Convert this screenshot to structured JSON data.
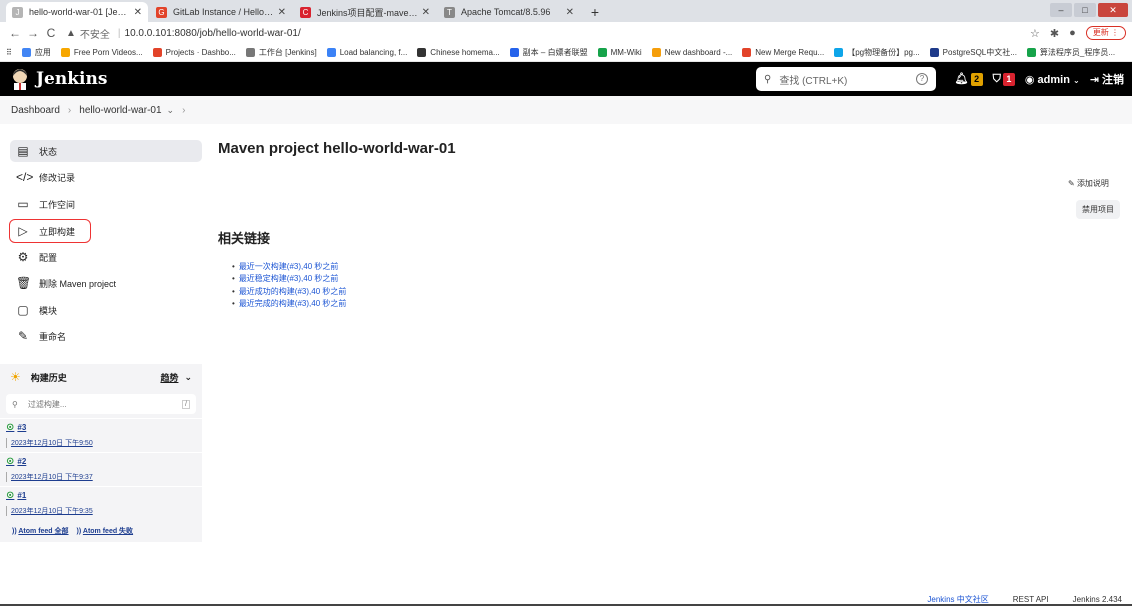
{
  "browser": {
    "tabs": [
      {
        "label": "hello-world-war-01 [Jenkins]",
        "color": "#b5b5b5",
        "active": true
      },
      {
        "label": "GitLab Instance / Hello World",
        "color": "#e24329",
        "active": false
      },
      {
        "label": "Jenkins项目配置-maven项目-全",
        "color": "#d9232f",
        "active": false
      },
      {
        "label": "Apache Tomcat/8.5.96",
        "color": "#888888",
        "active": false
      }
    ],
    "security_label": "不安全",
    "url": "10.0.0.101:8080/job/hello-world-war-01/",
    "update_label": "更新",
    "bookmarks": [
      {
        "label": "应用",
        "color": "#4285f4"
      },
      {
        "label": "Free Porn Videos...",
        "color": "#f7a700"
      },
      {
        "label": "Projects · Dashbo...",
        "color": "#e24329"
      },
      {
        "label": "工作台 [Jenkins]",
        "color": "#777777"
      },
      {
        "label": "Load balancing, f...",
        "color": "#3b82f6"
      },
      {
        "label": "Chinese homema...",
        "color": "#333333"
      },
      {
        "label": "副本 – 白嫖者联盟",
        "color": "#2563eb"
      },
      {
        "label": "MM-Wiki",
        "color": "#16a34a"
      },
      {
        "label": "New dashboard -...",
        "color": "#f59e0b"
      },
      {
        "label": "New Merge Requ...",
        "color": "#e24329"
      },
      {
        "label": "【pg物理备份】pg...",
        "color": "#0ea5e9"
      },
      {
        "label": "PostgreSQL中文社...",
        "color": "#1e3a8a"
      },
      {
        "label": "算法程序员_程序员...",
        "color": "#16a34a"
      }
    ]
  },
  "header": {
    "logo_text": "Jenkins",
    "search_placeholder": "查找 (CTRL+K)",
    "notifications_count": "2",
    "security_count": "1",
    "user": "admin",
    "logout": "注销"
  },
  "breadcrumb": {
    "dashboard": "Dashboard",
    "job": "hello-world-war-01"
  },
  "sidebar": {
    "tasks": [
      {
        "label": "状态",
        "icon": "status-icon"
      },
      {
        "label": "修改记录",
        "icon": "code-icon"
      },
      {
        "label": "工作空间",
        "icon": "folder-icon"
      },
      {
        "label": "立即构建",
        "icon": "play-icon"
      },
      {
        "label": "配置",
        "icon": "gear-icon"
      },
      {
        "label": "删除 Maven project",
        "icon": "trash-icon"
      },
      {
        "label": "模块",
        "icon": "document-icon"
      },
      {
        "label": "重命名",
        "icon": "pencil-icon"
      }
    ]
  },
  "build_history": {
    "title": "构建历史",
    "trend": "趋势",
    "filter_placeholder": "过滤构建...",
    "shortcut": "/",
    "builds": [
      {
        "number": "#3",
        "date": "2023年12月10日 下午9:50"
      },
      {
        "number": "#2",
        "date": "2023年12月10日 下午9:37"
      },
      {
        "number": "#1",
        "date": "2023年12月10日 下午9:35"
      }
    ],
    "feed_all": "Atom feed 全部",
    "feed_fail": "Atom feed 失败"
  },
  "main": {
    "title": "Maven project hello-world-war-01",
    "add_description": "添加说明",
    "disable_project": "禁用项目",
    "related_title": "相关链接",
    "related_links": [
      "最近一次构建(#3),40 秒之前",
      "最近稳定构建(#3),40 秒之前",
      "最近成功的构建(#3),40 秒之前",
      "最近完成的构建(#3),40 秒之前"
    ]
  },
  "footer": {
    "community": "Jenkins 中文社区",
    "rest_api": "REST API",
    "version": "Jenkins 2.434"
  }
}
